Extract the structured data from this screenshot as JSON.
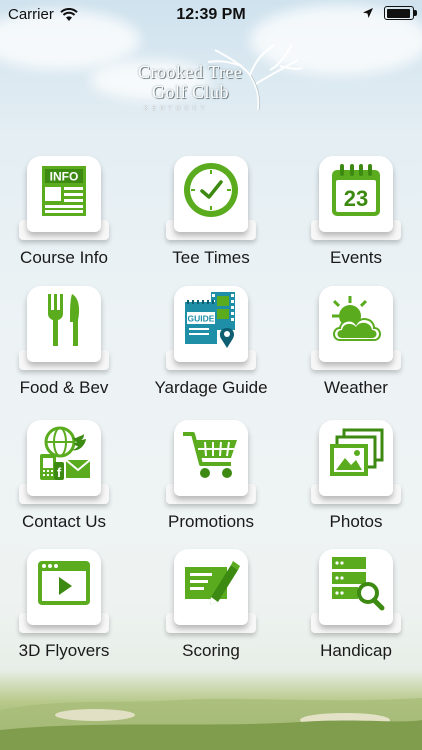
{
  "status_bar": {
    "carrier": "Carrier",
    "time": "12:39 PM",
    "battery_level": 0.95
  },
  "logo": {
    "line1": "Crooked Tree",
    "line2": "Golf Club",
    "sub": "KENTUCKY"
  },
  "tiles": [
    {
      "label": "Course Info",
      "icon": "info-icon"
    },
    {
      "label": "Tee Times",
      "icon": "clock-icon"
    },
    {
      "label": "Events",
      "icon": "calendar-icon",
      "calendar_day": "23"
    },
    {
      "label": "Food & Bev",
      "icon": "fork-knife-icon"
    },
    {
      "label": "Yardage Guide",
      "icon": "guide-map-icon",
      "guide_text": "GUIDE"
    },
    {
      "label": "Weather",
      "icon": "sun-cloud-icon"
    },
    {
      "label": "Contact Us",
      "icon": "globe-phone-mail-icon"
    },
    {
      "label": "Promotions",
      "icon": "shopping-cart-icon"
    },
    {
      "label": "Photos",
      "icon": "photos-icon"
    },
    {
      "label": "3D Flyovers",
      "icon": "video-play-icon"
    },
    {
      "label": "Scoring",
      "icon": "scorecard-pencil-icon"
    },
    {
      "label": "Handicap",
      "icon": "database-search-icon"
    }
  ],
  "colors": {
    "accent": "#5aab1e",
    "accent_dark": "#3d8a12",
    "teal": "#1f8fa8"
  }
}
